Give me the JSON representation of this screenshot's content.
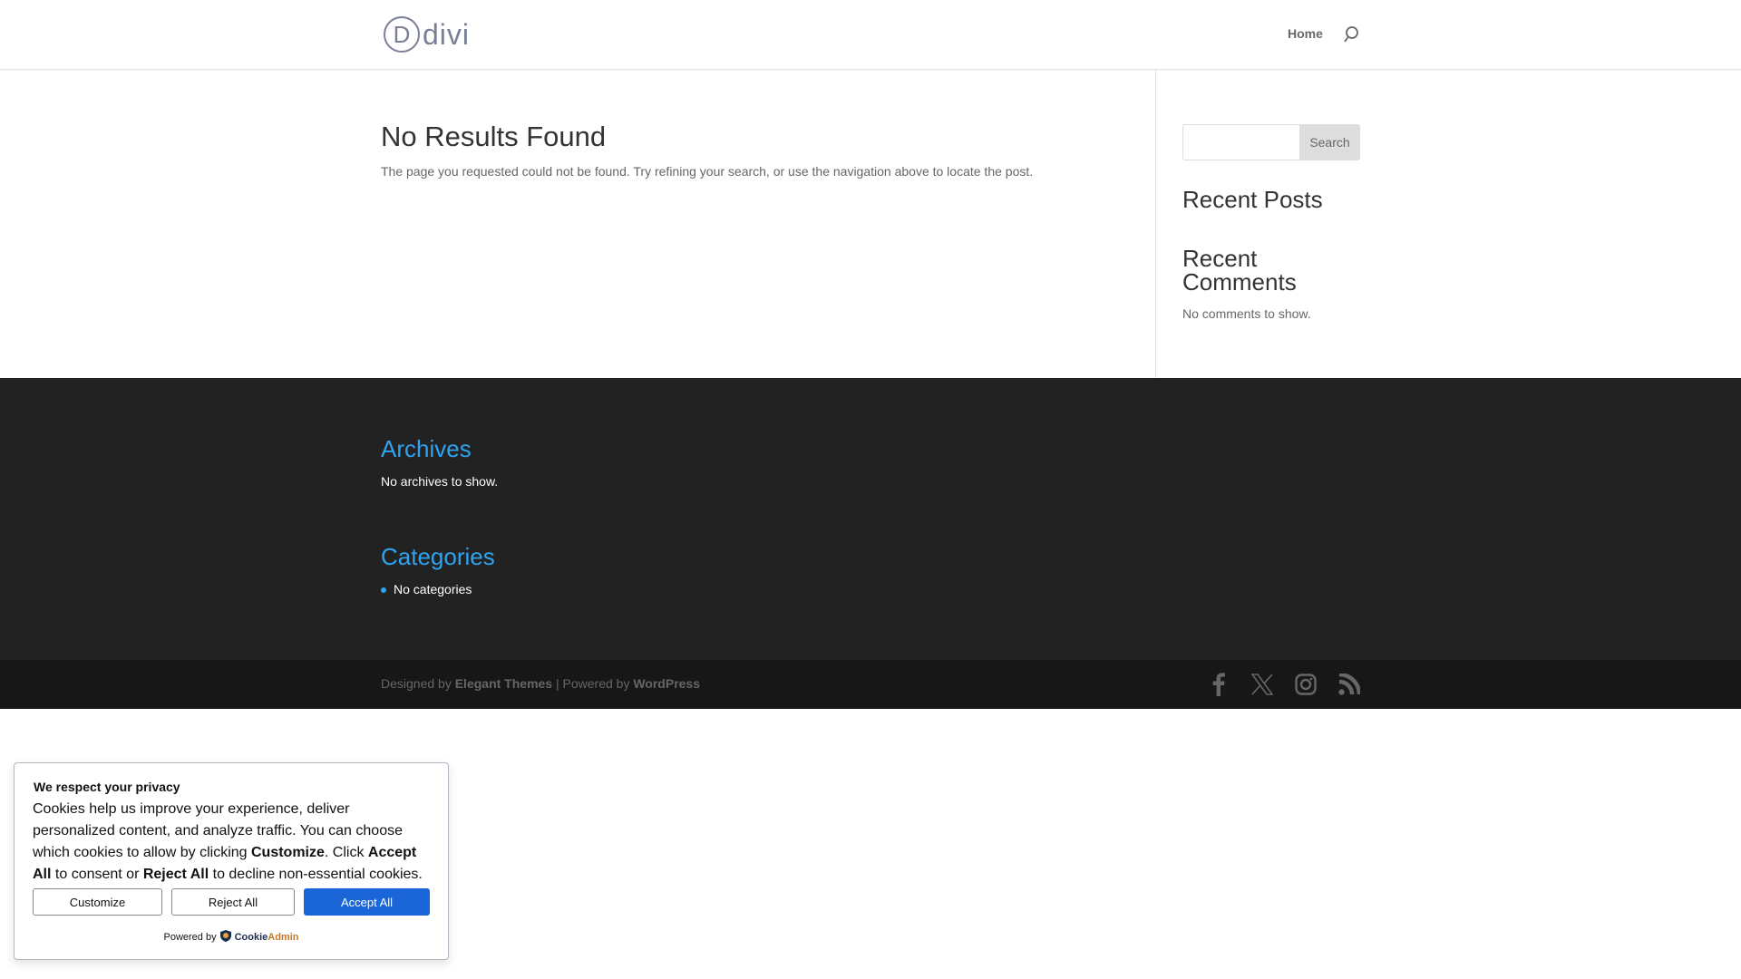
{
  "header": {
    "logo_letter": "D",
    "logo_word": "divi",
    "nav": [
      {
        "label": "Home"
      }
    ]
  },
  "main": {
    "title": "No Results Found",
    "message": "The page you requested could not be found. Try refining your search, or use the navigation above to locate the post."
  },
  "sidebar": {
    "search_placeholder": "",
    "search_button": "Search",
    "recent_posts": "Recent Posts",
    "recent_comments": "Recent Comments",
    "no_comments": "No comments to show."
  },
  "footer": {
    "archives_title": "Archives",
    "no_archives": "No archives to show.",
    "categories_title": "Categories",
    "categories": [
      "No categories"
    ],
    "credits": {
      "designed_by": "Designed by ",
      "elegant": "Elegant Themes",
      "sep": " | Powered by ",
      "wordpress": "WordPress"
    },
    "social": [
      "facebook",
      "x",
      "instagram",
      "rss"
    ]
  },
  "cookie": {
    "title": "We respect your privacy",
    "msg_1": "Cookies help us improve your experience, deliver personalized content, and analyze traffic. You can choose which cookies to allow by clicking ",
    "msg_customize": "Customize",
    "msg_2": ". Click ",
    "msg_accept": "Accept All",
    "msg_3": " to consent or ",
    "msg_reject": "Reject All",
    "msg_4": " to decline non-essential cookies.",
    "customize_button": "Customize",
    "reject_button": "Reject All",
    "accept_button": "Accept All",
    "powered_by": "Powered by",
    "brand_1": "Cookie",
    "brand_2": "Admin"
  },
  "colors": {
    "accent": "#2ea3f2",
    "accept": "#1a66d9"
  }
}
